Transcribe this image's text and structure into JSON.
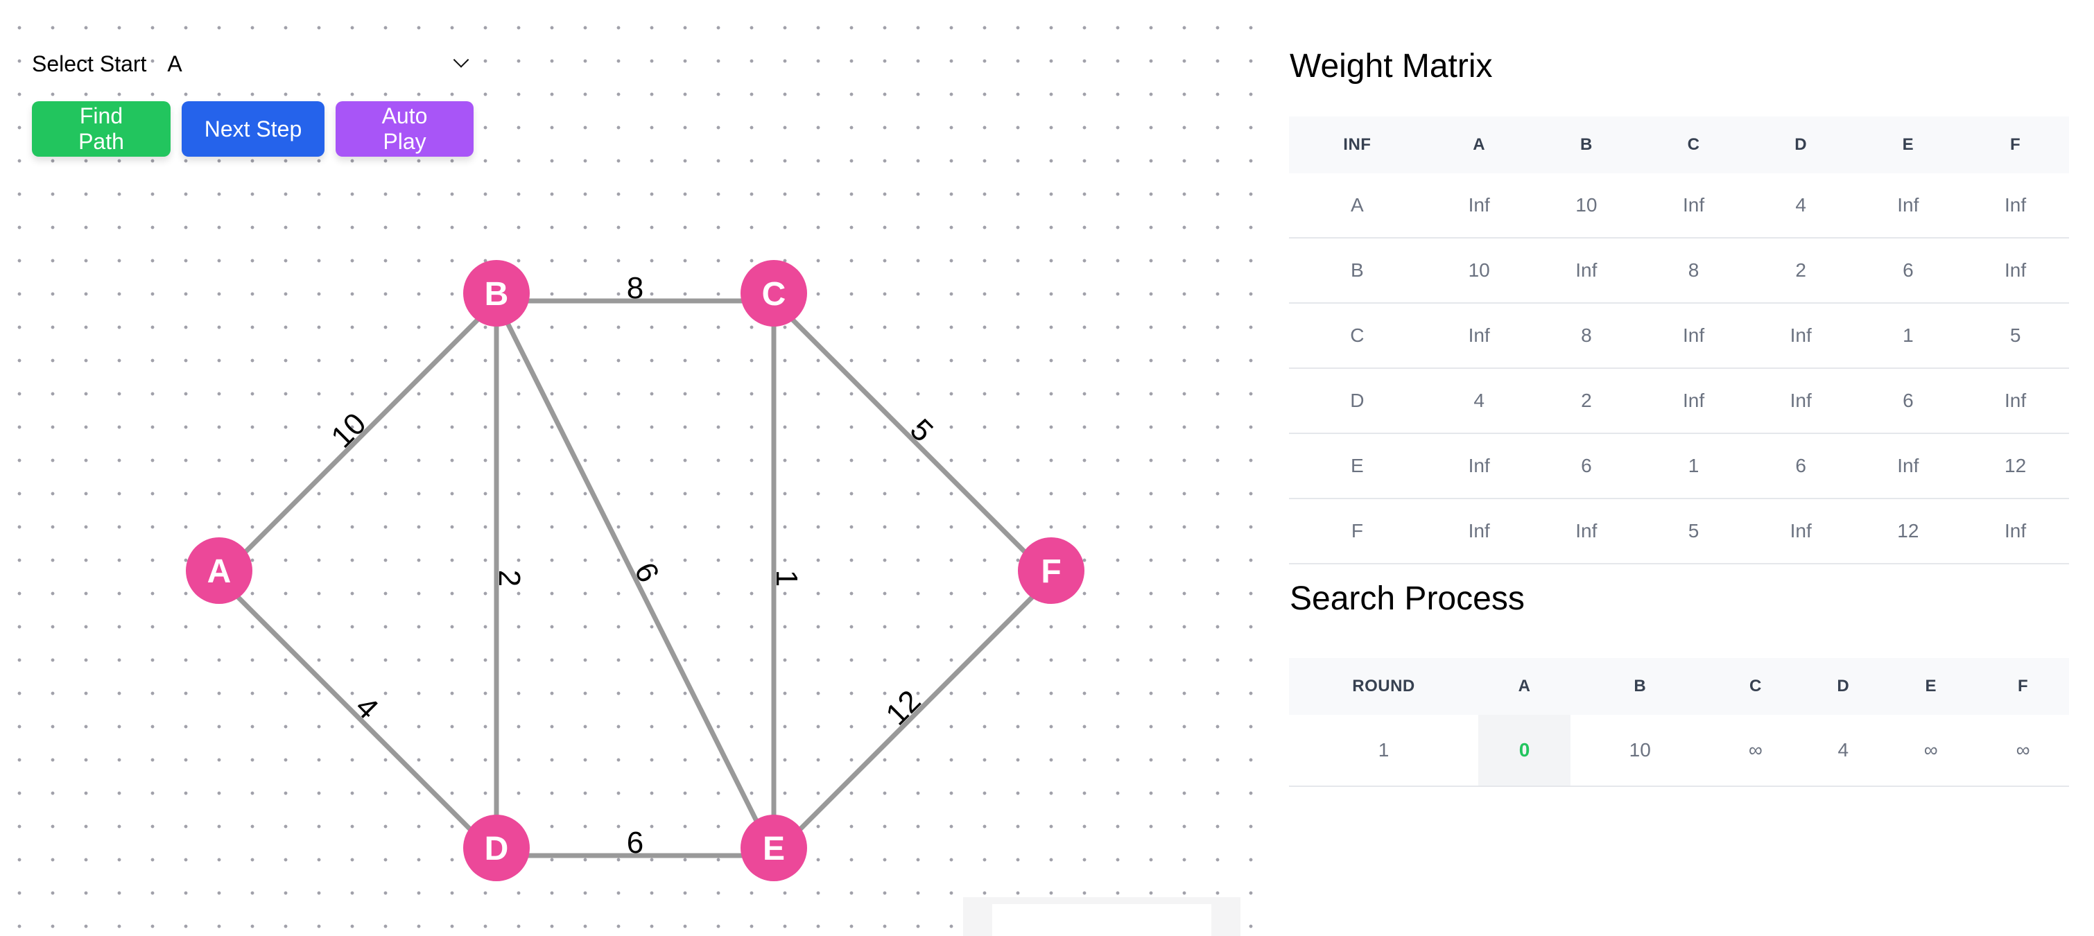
{
  "controls": {
    "select_label": "Select Start",
    "select_value": "A",
    "buttons": {
      "find_path": "Find Path",
      "next_step": "Next Step",
      "auto_play": "Auto Play"
    },
    "colors": {
      "find_path": "#22c55e",
      "next_step": "#2563eb",
      "auto_play": "#a855f7"
    }
  },
  "graph": {
    "node_color": "#ec4899",
    "edge_color": "#999999",
    "nodes": [
      {
        "id": "A",
        "col": 0,
        "row": 1
      },
      {
        "id": "B",
        "col": 1,
        "row": 0
      },
      {
        "id": "C",
        "col": 2,
        "row": 0
      },
      {
        "id": "D",
        "col": 1,
        "row": 2
      },
      {
        "id": "E",
        "col": 2,
        "row": 2
      },
      {
        "id": "F",
        "col": 3,
        "row": 1
      }
    ],
    "edges": [
      {
        "from": "A",
        "to": "B",
        "weight": "10"
      },
      {
        "from": "A",
        "to": "D",
        "weight": "4"
      },
      {
        "from": "B",
        "to": "C",
        "weight": "8"
      },
      {
        "from": "B",
        "to": "D",
        "weight": "2"
      },
      {
        "from": "B",
        "to": "E",
        "weight": "6"
      },
      {
        "from": "C",
        "to": "E",
        "weight": "1"
      },
      {
        "from": "C",
        "to": "F",
        "weight": "5"
      },
      {
        "from": "D",
        "to": "E",
        "weight": "6"
      },
      {
        "from": "E",
        "to": "F",
        "weight": "12"
      }
    ]
  },
  "weight_matrix": {
    "title": "Weight Matrix",
    "headers": [
      "INF",
      "A",
      "B",
      "C",
      "D",
      "E",
      "F"
    ],
    "rows": [
      [
        "A",
        "Inf",
        "10",
        "Inf",
        "4",
        "Inf",
        "Inf"
      ],
      [
        "B",
        "10",
        "Inf",
        "8",
        "2",
        "6",
        "Inf"
      ],
      [
        "C",
        "Inf",
        "8",
        "Inf",
        "Inf",
        "1",
        "5"
      ],
      [
        "D",
        "4",
        "2",
        "Inf",
        "Inf",
        "6",
        "Inf"
      ],
      [
        "E",
        "Inf",
        "6",
        "1",
        "6",
        "Inf",
        "12"
      ],
      [
        "F",
        "Inf",
        "Inf",
        "5",
        "Inf",
        "12",
        "Inf"
      ]
    ]
  },
  "search_process": {
    "title": "Search Process",
    "headers": [
      "ROUND",
      "A",
      "B",
      "C",
      "D",
      "E",
      "F"
    ],
    "rows": [
      {
        "cells": [
          "1",
          "0",
          "10",
          "∞",
          "4",
          "∞",
          "∞"
        ],
        "active_col": 1
      }
    ]
  }
}
